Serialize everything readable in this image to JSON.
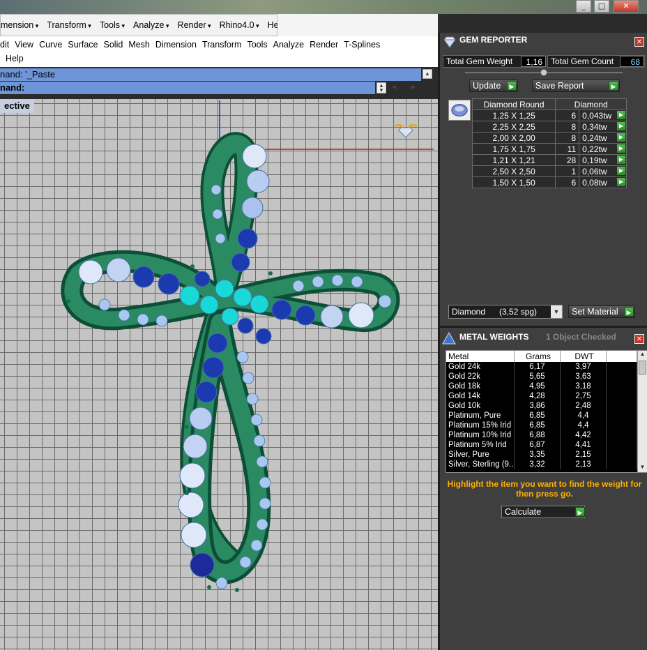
{
  "window": {
    "min_icon": "minimize-icon",
    "max_icon": "maximize-icon",
    "close_icon": "close-icon"
  },
  "main_menu": [
    "mension",
    "Transform",
    "Tools",
    "Analyze",
    "Render",
    "Rhino4.0",
    "Help"
  ],
  "rhino_menu": {
    "row1": [
      "dit",
      "View",
      "Curve",
      "Surface",
      "Solid",
      "Mesh",
      "Dimension",
      "Transform",
      "Tools",
      "Analyze",
      "Render",
      "T-Splines"
    ],
    "row2": [
      "Help"
    ]
  },
  "command": {
    "line1": "nand: '_Paste",
    "line2": "nand:"
  },
  "viewport": {
    "title": "ective"
  },
  "gem_reporter": {
    "title": "GEM REPORTER",
    "total_weight_label": "Total Gem Weight",
    "total_weight_value": "1,16",
    "total_count_label": "Total Gem Count",
    "total_count_value": "68",
    "update_label": "Update",
    "save_report_label": "Save Report",
    "col_shape": "Diamond Round",
    "col_type": "Diamond",
    "rows": [
      {
        "size": "1,25 X 1,25",
        "count": "6",
        "weight": "0,043tw"
      },
      {
        "size": "2,25 X 2,25",
        "count": "8",
        "weight": "0,34tw"
      },
      {
        "size": "2,00 X 2,00",
        "count": "8",
        "weight": "0,24tw"
      },
      {
        "size": "1,75 X 1,75",
        "count": "11",
        "weight": "0,22tw"
      },
      {
        "size": "1,21 X 1,21",
        "count": "28",
        "weight": "0,19tw"
      },
      {
        "size": "2,50 X 2,50",
        "count": "1",
        "weight": "0,06tw"
      },
      {
        "size": "1,50 X 1,50",
        "count": "6",
        "weight": "0,08tw"
      }
    ],
    "material_select": "Diamond      (3,52 spg)",
    "set_material_label": "Set Material"
  },
  "metal_weights": {
    "title": "METAL WEIGHTS",
    "status": "1 Object Checked",
    "headers": [
      "Metal",
      "Grams",
      "DWT"
    ],
    "rows": [
      {
        "metal": "Gold 24k",
        "grams": "6,17",
        "dwt": "3,97"
      },
      {
        "metal": "Gold 22k",
        "grams": "5,65",
        "dwt": "3,63"
      },
      {
        "metal": "Gold 18k",
        "grams": "4,95",
        "dwt": "3,18"
      },
      {
        "metal": "Gold 14k",
        "grams": "4,28",
        "dwt": "2,75"
      },
      {
        "metal": "Gold 10k",
        "grams": "3,86",
        "dwt": "2,48"
      },
      {
        "metal": "Platinum, Pure",
        "grams": "6,85",
        "dwt": "4,4"
      },
      {
        "metal": "Platinum 15% Irid",
        "grams": "6,85",
        "dwt": "4,4"
      },
      {
        "metal": "Platinum 10% Irid",
        "grams": "6,88",
        "dwt": "4,42"
      },
      {
        "metal": "Platinum 5% Irid",
        "grams": "6,87",
        "dwt": "4,41"
      },
      {
        "metal": "Silver, Pure",
        "grams": "3,35",
        "dwt": "2,15"
      },
      {
        "metal": "Silver, Sterling (9...",
        "grams": "3,32",
        "dwt": "2,13"
      }
    ],
    "hint": "Highlight the item you want to find the weight for then press go.",
    "calculate_label": "Calculate"
  }
}
